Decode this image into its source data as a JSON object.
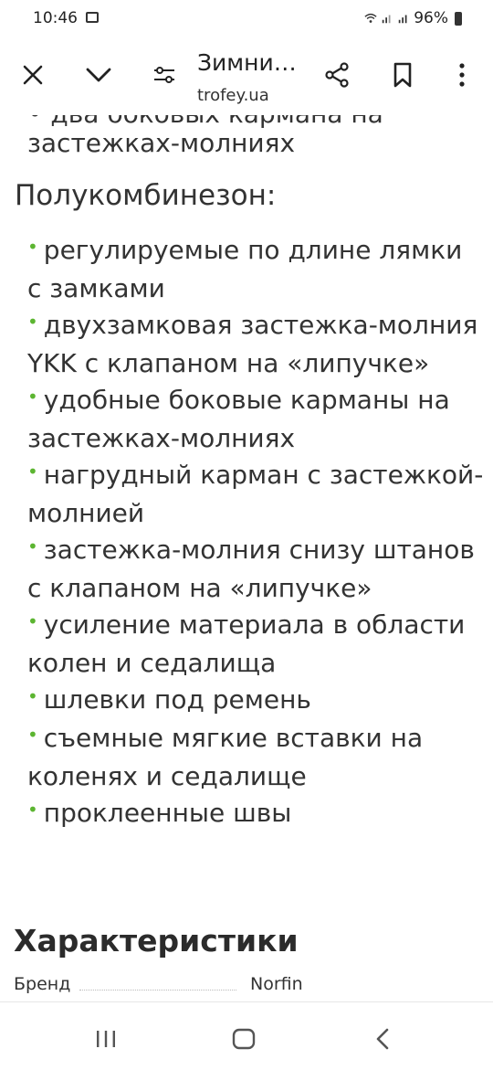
{
  "status_bar": {
    "time": "10:46",
    "battery": "96%",
    "icons": [
      "gallery-icon",
      "wifi-icon",
      "signal-icon",
      "signal-icon",
      "battery-icon"
    ]
  },
  "toolbar": {
    "title": "Зимни…",
    "url": "trofey.ua",
    "icons": [
      "close-icon",
      "chevron-down-icon",
      "tune-icon",
      "share-icon",
      "bookmark-icon",
      "more-vert-icon"
    ]
  },
  "content": {
    "cut_line": "• два боковых кармана на",
    "prev_tail": "застежках-молниях",
    "section_heading": "Полукомбинезон:",
    "bullet": "•",
    "items": [
      "регулируемые по длине лямки с замками",
      "двухзамковая застежка-молния YKK с клапаном на «липучке»",
      "удобные боковые карманы на застежках-молниях",
      "нагрудный карман с застежкой-молнией",
      "застежка-молния снизу штанов с клапаном на «липучке»",
      "усиление материала в области колен и седалища",
      "шлевки под ремень",
      "съемные мягкие вставки на коленях и седалище",
      "проклеенные швы"
    ],
    "characteristics_heading": "Характеристики",
    "brand_label": "Бренд",
    "brand_value": "Norfin"
  },
  "colors": {
    "bullet": "#5cb531",
    "text": "#333333"
  },
  "nav_bar": {
    "icons": [
      "recents-icon",
      "home-icon",
      "back-icon"
    ]
  }
}
